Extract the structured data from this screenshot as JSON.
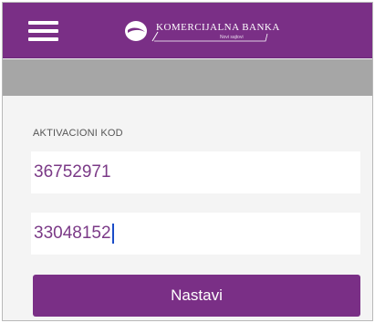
{
  "header": {
    "menu_icon": "hamburger-menu-icon",
    "logo": {
      "name": "KOMERCIJALNA BANKA",
      "tagline": "Novi sajtovi"
    }
  },
  "form": {
    "label": "AKTIVACIONI KOD",
    "code_first": "36752971",
    "code_second": "33048152",
    "submit_label": "Nastavi"
  },
  "colors": {
    "brand_purple": "#7a2f86",
    "grey_bar": "#a6a6a6",
    "input_text": "#7b3a87",
    "background": "#f4f4f4"
  }
}
